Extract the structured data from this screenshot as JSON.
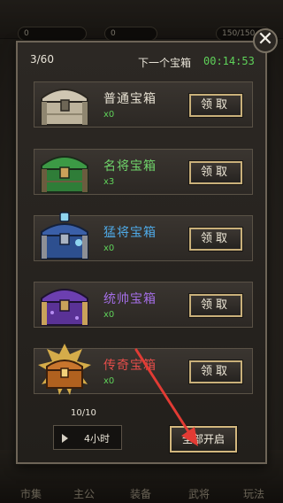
{
  "background": {
    "resources": [
      "0",
      "0",
      "150/150"
    ],
    "nav": [
      "市集",
      "主公",
      "装备",
      "武将",
      "玩法"
    ]
  },
  "modal": {
    "count": "3/60",
    "next_label": "下一个宝箱",
    "timer": "00:14:53",
    "close_symbol": "✕",
    "chests": [
      {
        "name": "普通宝箱",
        "qty": "x0",
        "color": "#e6e0d2",
        "icon": "common-chest-icon"
      },
      {
        "name": "名将宝箱",
        "qty": "x3",
        "color": "#6fd36a",
        "icon": "famous-general-chest-icon"
      },
      {
        "name": "猛将宝箱",
        "qty": "x0",
        "color": "#4fa9e6",
        "icon": "fierce-general-chest-icon"
      },
      {
        "name": "统帅宝箱",
        "qty": "x0",
        "color": "#a46ee6",
        "icon": "commander-chest-icon"
      },
      {
        "name": "传奇宝箱",
        "qty": "x0",
        "color": "#e44d4a",
        "icon": "legendary-chest-icon"
      }
    ],
    "claim_label": "领取",
    "progress": "10/10",
    "duration": "4小时",
    "open_all": "全部开启"
  },
  "colors": {
    "accent_green": "#5fd25a",
    "arrow_red": "#e23b34",
    "button_gold": "#c9b07a"
  }
}
